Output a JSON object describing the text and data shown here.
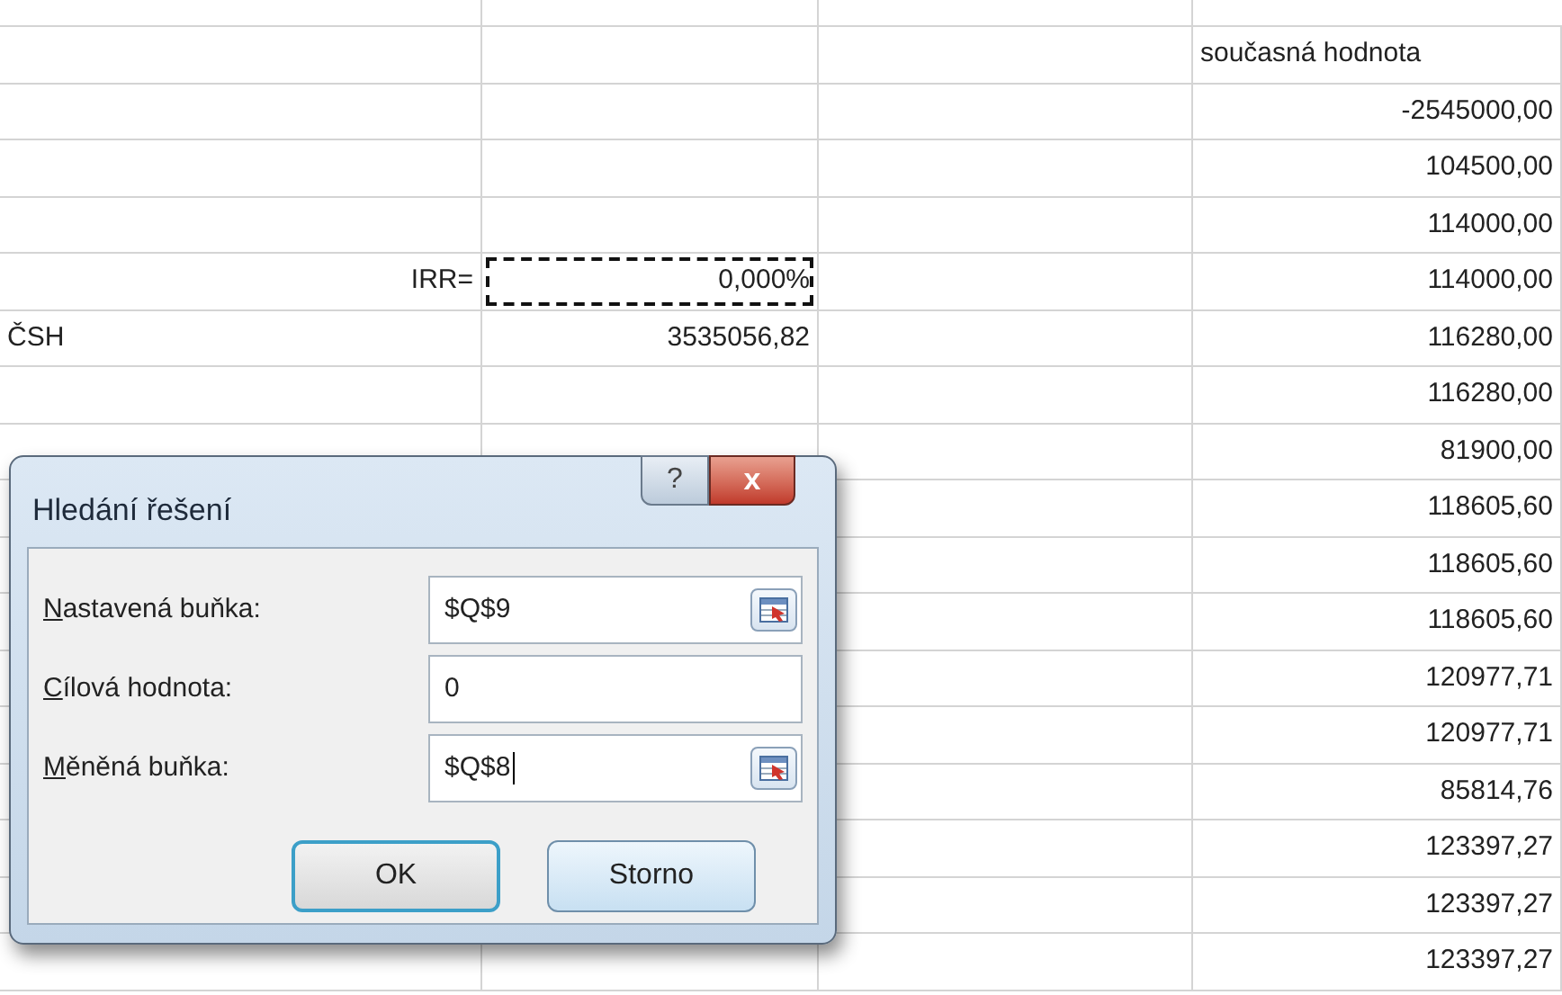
{
  "sheet": {
    "rows": [
      {
        "kind": "header",
        "column_4": "současná hodnota"
      },
      {
        "column_4": "-2545000,00"
      },
      {
        "column_4": "104500,00"
      },
      {
        "column_4": "114000,00"
      },
      {
        "kind": "target",
        "column_1": "IRR=",
        "column_2": "0,000%",
        "marquee": true,
        "column_4": "114000,00"
      },
      {
        "kind": "total",
        "column_1": "ČSH",
        "column_2": "3535056,82",
        "column_4": "116280,00"
      },
      {
        "column_4": "116280,00"
      },
      {
        "column_4": "81900,00"
      },
      {
        "column_4": "118605,60"
      },
      {
        "column_4": "118605,60"
      },
      {
        "column_4": "118605,60"
      },
      {
        "column_4": "120977,71"
      },
      {
        "column_4": "120977,71"
      },
      {
        "column_4": "85814,76"
      },
      {
        "column_4": "123397,27"
      },
      {
        "column_4": "123397,27"
      },
      {
        "column_4": "123397,27"
      }
    ]
  },
  "dialog": {
    "title": "Hledání řešení",
    "help": "?",
    "close": "x",
    "fields": [
      {
        "label": "Nastavená buňka:",
        "value": "$Q$9",
        "picker": true,
        "focused": false
      },
      {
        "label": "Cílová hodnota:",
        "value": "0",
        "picker": false,
        "focused": false
      },
      {
        "label": "Měněná buňka:",
        "value": "$Q$8",
        "picker": true,
        "focused": true
      }
    ],
    "buttons": [
      {
        "label": "OK",
        "default": true
      },
      {
        "label": "Storno",
        "default": false
      }
    ]
  }
}
